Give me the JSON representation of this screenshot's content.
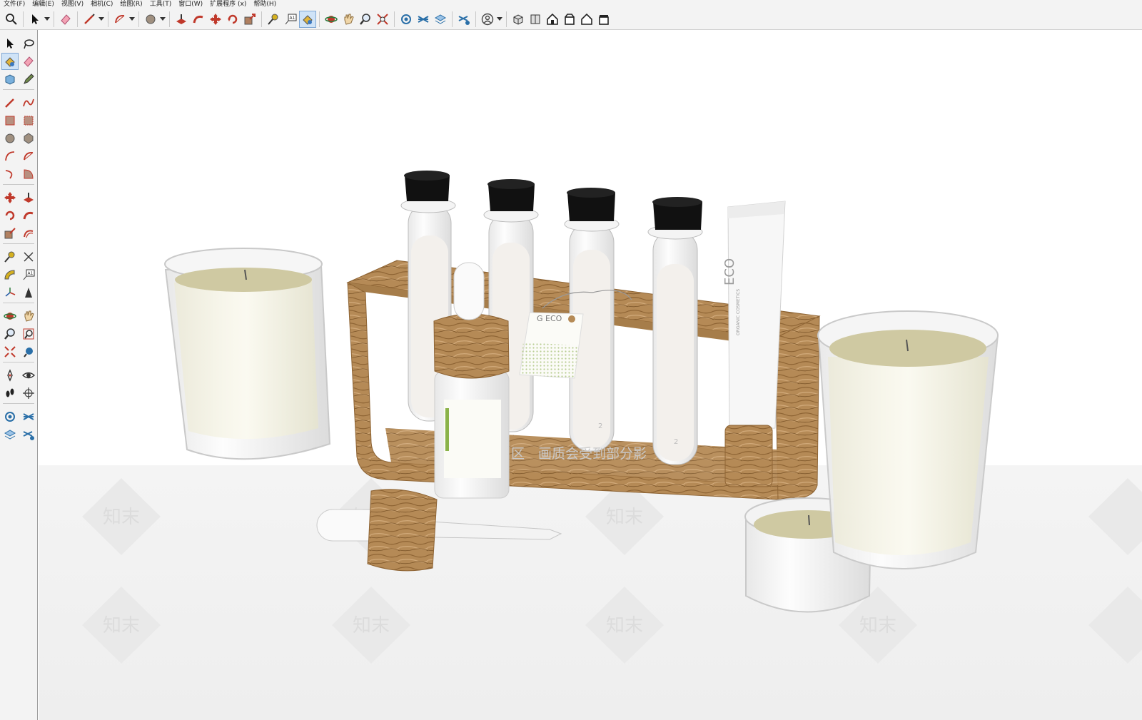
{
  "menu": {
    "file": "文件(F)",
    "edit": "编辑(E)",
    "view": "视图(V)",
    "camera": "相机(C)",
    "draw": "绘图(R)",
    "tools": "工具(T)",
    "window": "窗口(W)",
    "extensions": "扩展程序 (x)",
    "help": "帮助(H)"
  },
  "scene": {
    "watermark_text": "知末",
    "preview_notice": "区　画质会受到部分影",
    "tag_text": "G ECO",
    "tube_text": "ECO",
    "tube_subtext": "ORGANIC COSMETICS",
    "test_tube_number": "2"
  },
  "colors": {
    "toolbar_bg": "#f3f3f3",
    "active_tool": "#cfe3f7",
    "wood": "#b58a56",
    "cork": "#111111",
    "wax": "#cfc9a2"
  }
}
